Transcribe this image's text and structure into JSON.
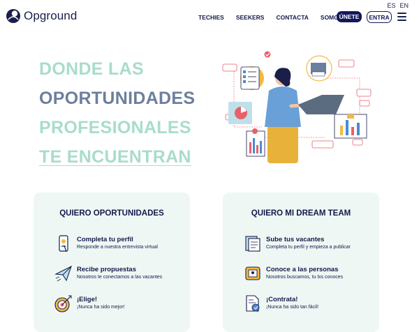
{
  "lang": {
    "es": "ES",
    "en": "EN"
  },
  "brand": {
    "name": "Opground"
  },
  "nav": [
    "TECHIES",
    "SEEKERS",
    "CONTACTA",
    "SOMOS"
  ],
  "buttons": {
    "join": "ÚNETE",
    "login": "ENTRA"
  },
  "hero": {
    "line1": "DONDE LAS",
    "line2": "OPORTUNIDADES",
    "line3": "PROFESIONALES",
    "line4": "TE ENCUENTRAN"
  },
  "cards": [
    {
      "title": "QUIERO OPORTUNIDADES",
      "items": [
        {
          "title": "Completa tu perfil",
          "subtitle": "Responde a nuestra entrevista virtual",
          "icon": "phone-profile-icon"
        },
        {
          "title": "Recibe propuestas",
          "subtitle": "Nosotros te conectamos a las vacantes",
          "icon": "paper-plane-icon"
        },
        {
          "title": "¡Elige!",
          "subtitle": "¡Nunca ha sido mejor!",
          "icon": "target-icon"
        }
      ]
    },
    {
      "title": "QUIERO MI DREAM TEAM",
      "items": [
        {
          "title": "Sube tus vacantes",
          "subtitle": "Completa tu perfil y empieza a publicar",
          "icon": "documents-icon"
        },
        {
          "title": "Conoce a las personas",
          "subtitle": "Nosotros buscamos, tu lxs conoces",
          "icon": "profile-cards-icon"
        },
        {
          "title": "¡Contrata!",
          "subtitle": "¡Nunca ha sido tan fácil!",
          "icon": "contract-icon"
        }
      ]
    }
  ],
  "colors": {
    "navy": "#141a4a",
    "mint": "#a9dccd",
    "slate": "#6c7f9c",
    "card_bg": "#eef7f4"
  }
}
